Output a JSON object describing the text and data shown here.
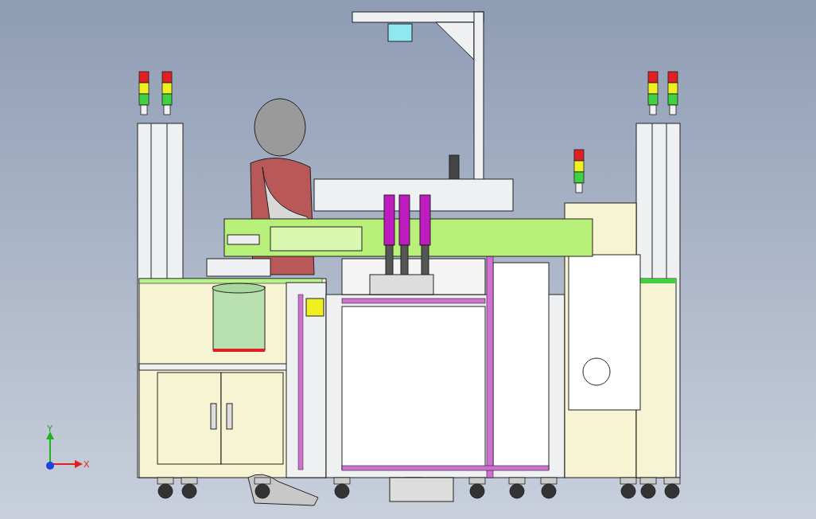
{
  "viewport": {
    "axis_triad": {
      "y_label": "Y",
      "x_label": "X"
    }
  }
}
